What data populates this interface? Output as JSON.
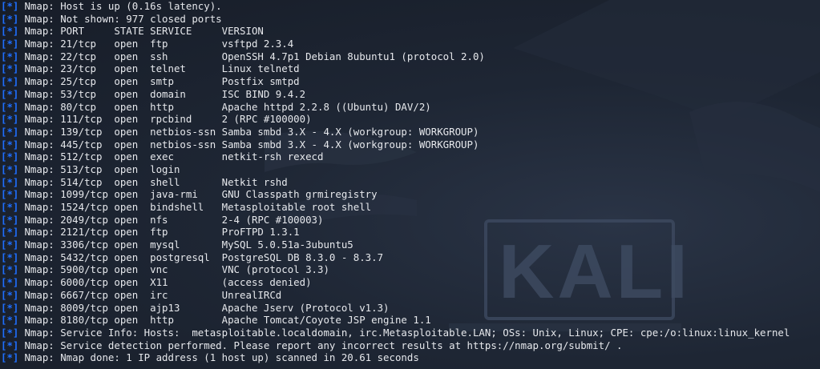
{
  "terminal": {
    "marker": "[*]",
    "wallpaper_text": "KALI",
    "lines": [
      "Nmap: Host is up (0.16s latency).",
      "Nmap: Not shown: 977 closed ports",
      "Nmap: PORT     STATE SERVICE     VERSION",
      "Nmap: 21/tcp   open  ftp         vsftpd 2.3.4",
      "Nmap: 22/tcp   open  ssh         OpenSSH 4.7p1 Debian 8ubuntu1 (protocol 2.0)",
      "Nmap: 23/tcp   open  telnet      Linux telnetd",
      "Nmap: 25/tcp   open  smtp        Postfix smtpd",
      "Nmap: 53/tcp   open  domain      ISC BIND 9.4.2",
      "Nmap: 80/tcp   open  http        Apache httpd 2.2.8 ((Ubuntu) DAV/2)",
      "Nmap: 111/tcp  open  rpcbind     2 (RPC #100000)",
      "Nmap: 139/tcp  open  netbios-ssn Samba smbd 3.X - 4.X (workgroup: WORKGROUP)",
      "Nmap: 445/tcp  open  netbios-ssn Samba smbd 3.X - 4.X (workgroup: WORKGROUP)",
      "Nmap: 512/tcp  open  exec        netkit-rsh rexecd",
      "Nmap: 513/tcp  open  login",
      "Nmap: 514/tcp  open  shell       Netkit rshd",
      "Nmap: 1099/tcp open  java-rmi    GNU Classpath grmiregistry",
      "Nmap: 1524/tcp open  bindshell   Metasploitable root shell",
      "Nmap: 2049/tcp open  nfs         2-4 (RPC #100003)",
      "Nmap: 2121/tcp open  ftp         ProFTPD 1.3.1",
      "Nmap: 3306/tcp open  mysql       MySQL 5.0.51a-3ubuntu5",
      "Nmap: 5432/tcp open  postgresql  PostgreSQL DB 8.3.0 - 8.3.7",
      "Nmap: 5900/tcp open  vnc         VNC (protocol 3.3)",
      "Nmap: 6000/tcp open  X11         (access denied)",
      "Nmap: 6667/tcp open  irc         UnrealIRCd",
      "Nmap: 8009/tcp open  ajp13       Apache Jserv (Protocol v1.3)",
      "Nmap: 8180/tcp open  http        Apache Tomcat/Coyote JSP engine 1.1",
      "Nmap: Service Info: Hosts:  metasploitable.localdomain, irc.Metasploitable.LAN; OSs: Unix, Linux; CPE: cpe:/o:linux:linux_kernel",
      "Nmap: Service detection performed. Please report any incorrect results at https://nmap.org/submit/ .",
      "Nmap: Nmap done: 1 IP address (1 host up) scanned in 20.61 seconds"
    ]
  }
}
